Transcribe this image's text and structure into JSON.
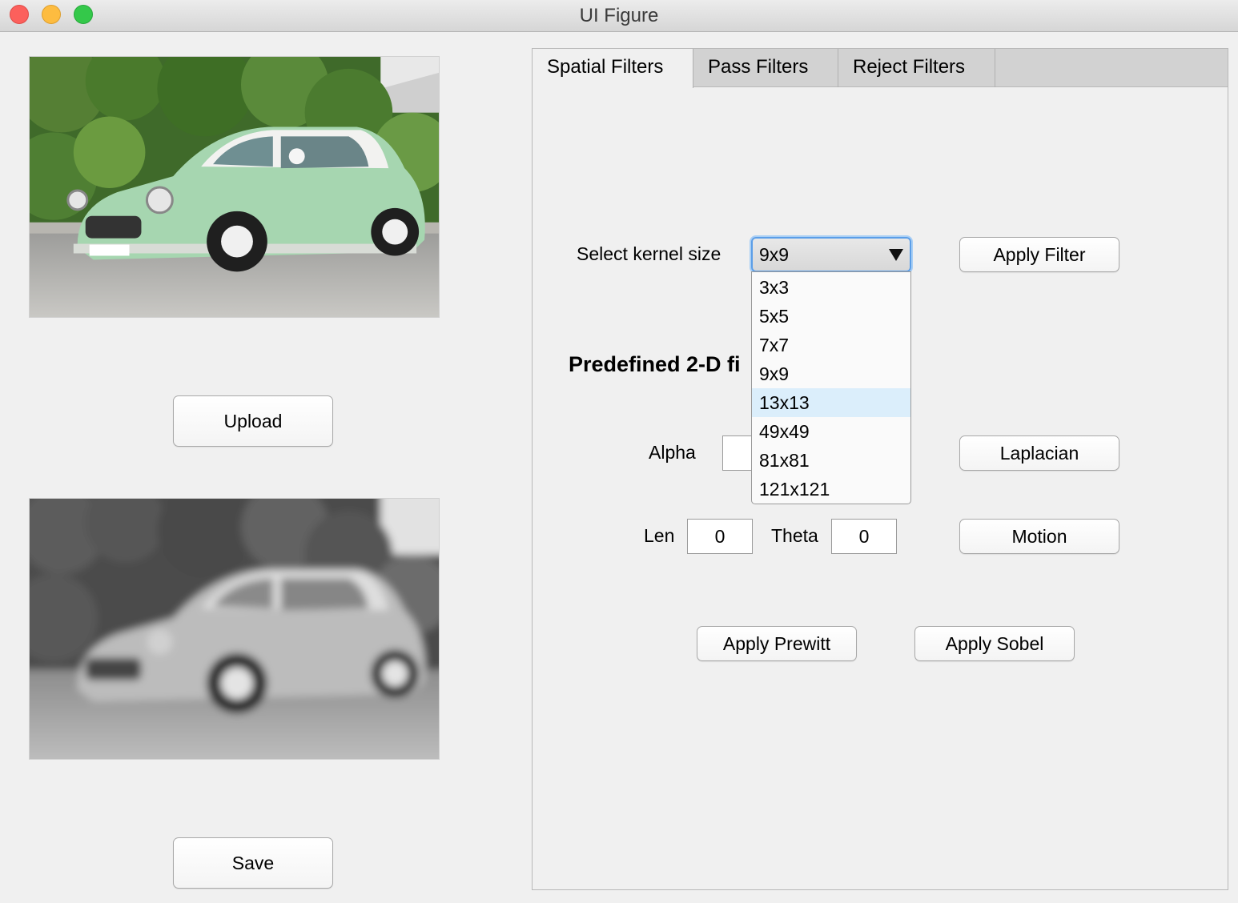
{
  "window": {
    "title": "UI Figure"
  },
  "left": {
    "upload_label": "Upload",
    "save_label": "Save"
  },
  "tabs": [
    {
      "label": "Spatial Filters",
      "active": true
    },
    {
      "label": "Pass Filters",
      "active": false
    },
    {
      "label": "Reject Filters",
      "active": false
    }
  ],
  "spatial": {
    "kernel_label": "Select kernel size",
    "kernel_selected": "9x9",
    "kernel_options": [
      "3x3",
      "5x5",
      "7x7",
      "9x9",
      "13x13",
      "49x49",
      "81x81",
      "121x121"
    ],
    "kernel_highlighted": "13x13",
    "apply_filter_label": "Apply Filter",
    "predefined_heading": "Predefined 2-D fi",
    "alpha_label": "Alpha",
    "laplacian_label": "Laplacian",
    "len_label": "Len",
    "len_value": "0",
    "theta_label": "Theta",
    "theta_value": "0",
    "motion_label": "Motion",
    "prewitt_label": "Apply Prewitt",
    "sobel_label": "Apply Sobel"
  },
  "colors": {
    "accent": "#5b9ee8",
    "highlight": "#dbeefb",
    "car_body": "#a6d6b0"
  }
}
